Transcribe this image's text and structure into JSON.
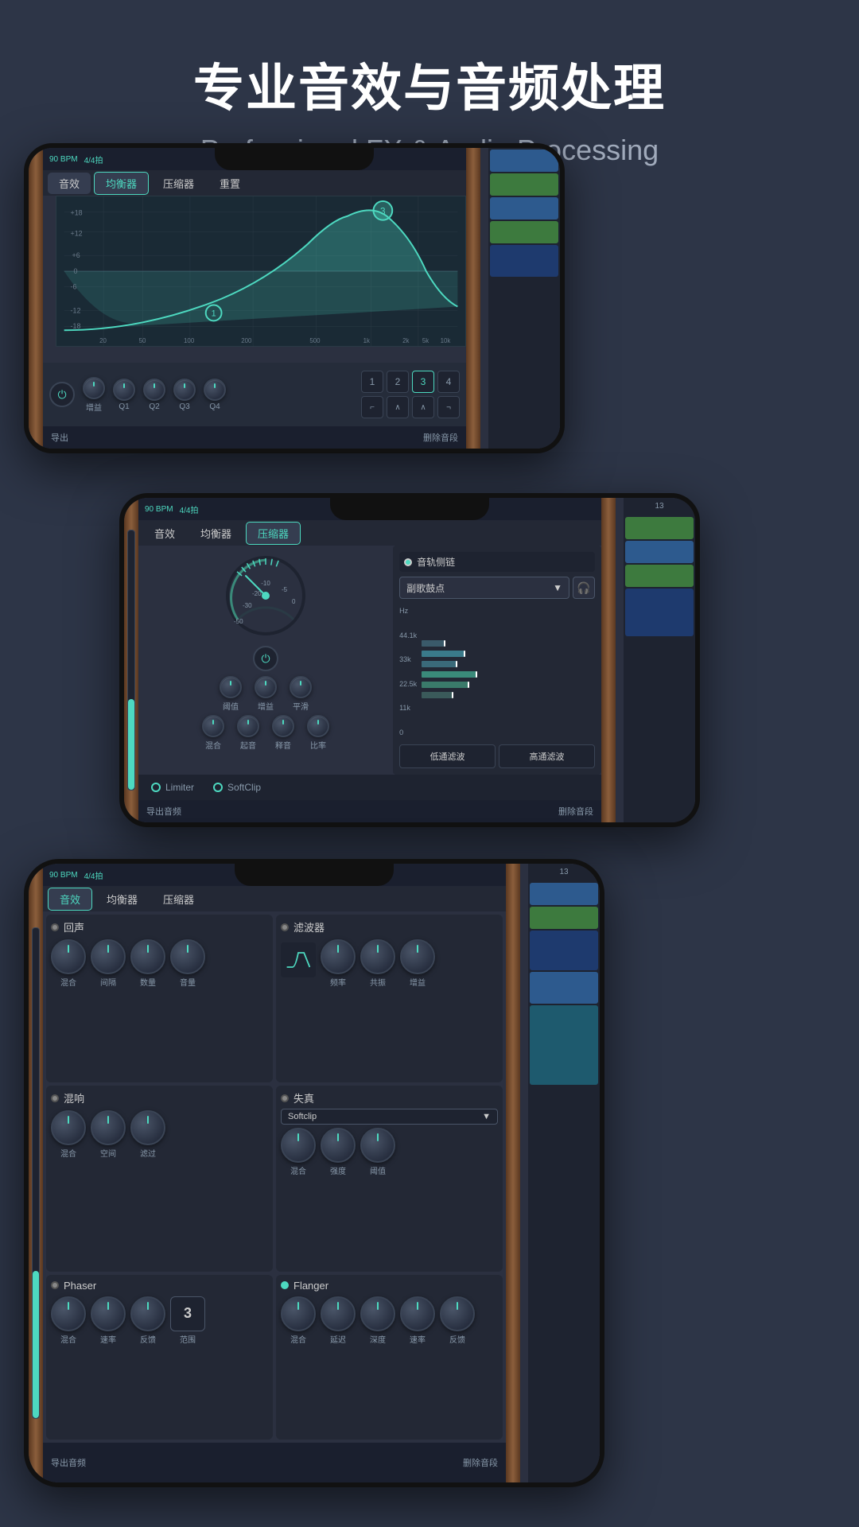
{
  "header": {
    "title_cn": "专业音效与音频处理",
    "title_en": "Professional FX & Audio Processing"
  },
  "screen1": {
    "bpm": "90 BPM",
    "time_sig": "4/4拍",
    "tabs": [
      "音效",
      "均衡器",
      "压缩器",
      "重置"
    ],
    "active_tab": 1,
    "knobs": [
      "增益",
      "Q1",
      "Q2",
      "Q3",
      "Q4"
    ],
    "bands": [
      "1",
      "2",
      "3",
      "4"
    ],
    "active_band": 2,
    "export": "导出",
    "delete_section": "删除音段"
  },
  "screen2": {
    "bpm": "90 BPM",
    "time_sig": "4/4拍",
    "tabs": [
      "音效",
      "均衡器",
      "压缩器"
    ],
    "active_tab": 2,
    "sidechain_label": "音轨侧链",
    "dropdown_value": "副歌鼓点",
    "knobs_row1": [
      "阈值",
      "增益",
      "平滑"
    ],
    "knobs_row2": [
      "起音",
      "释音",
      "比率"
    ],
    "mix_label": "混合",
    "freq_labels": [
      "Hz",
      "44.1k",
      "33k",
      "22.5k",
      "11k",
      "0"
    ],
    "filter_btns": [
      "低通滤波",
      "高通滤波"
    ],
    "options": [
      "Limiter",
      "SoftClip"
    ],
    "export": "导出音频",
    "delete_section": "删除音段"
  },
  "screen3": {
    "bpm": "90 BPM",
    "time_sig": "4/4拍",
    "tabs": [
      "音效",
      "均衡器",
      "压缩器"
    ],
    "active_tab": 0,
    "modules": {
      "reverb": {
        "label": "回声",
        "knobs": [
          "混合",
          "间隔",
          "数量",
          "音量"
        ]
      },
      "filter": {
        "label": "滤波器",
        "knobs": [
          "频率",
          "共振",
          "增益"
        ]
      },
      "chorus": {
        "label": "混响",
        "knobs": [
          "混合",
          "空间",
          "滤过"
        ]
      },
      "distortion": {
        "label": "失真",
        "dropdown": "Softclip",
        "knobs": [
          "混合",
          "强度",
          "阈值"
        ]
      },
      "phaser": {
        "label": "Phaser",
        "knobs": [
          "混合",
          "速率",
          "反馈"
        ],
        "number_display": "3",
        "extra_label": "范围"
      },
      "flanger": {
        "label": "Flanger",
        "knobs": [
          "混合",
          "延迟",
          "深度",
          "速率",
          "反馈"
        ]
      }
    },
    "export": "导出音频",
    "delete_section": "删除音段"
  },
  "colors": {
    "accent": "#4dd9c0",
    "bg_dark": "#1e2330",
    "bg_mid": "#2b3040",
    "wood": "#8B5E3C",
    "track_blue": "#2d5a8e",
    "track_green": "#3d7a3e"
  }
}
